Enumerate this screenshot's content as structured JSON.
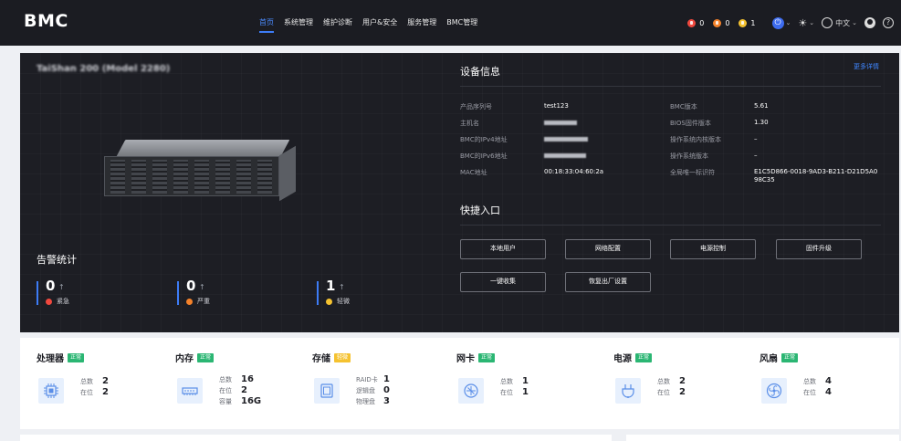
{
  "app": {
    "logo": "BMC"
  },
  "nav": {
    "items": [
      {
        "label": "首页",
        "active": true
      },
      {
        "label": "系统管理",
        "active": false
      },
      {
        "label": "维护诊断",
        "active": false
      },
      {
        "label": "用户&安全",
        "active": false
      },
      {
        "label": "服务管理",
        "active": false
      },
      {
        "label": "BMC管理",
        "active": false
      }
    ]
  },
  "toolbar": {
    "alarms": [
      {
        "count": "0",
        "color": "#f0483e",
        "icon": "critical-alarm-icon"
      },
      {
        "count": "0",
        "color": "#f5822a",
        "icon": "major-alarm-icon"
      },
      {
        "count": "1",
        "color": "#f5c230",
        "icon": "minor-alarm-icon"
      }
    ],
    "power_icon": "power-icon",
    "brightness_icon": "sun-icon",
    "language_label": "中文",
    "user_icon": "user-icon",
    "help_icon": "help-icon"
  },
  "hero": {
    "model_title": "TaiShan 200 (Model 2280)",
    "alarm_section_title": "告警统计",
    "alarm_stats": [
      {
        "count": "0",
        "label": "紧急",
        "color": "#f0483e"
      },
      {
        "count": "0",
        "label": "严重",
        "color": "#f5822a"
      },
      {
        "count": "1",
        "label": "轻微",
        "color": "#f5c230"
      }
    ],
    "device_info_title": "设备信息",
    "more_details_link": "更多详情",
    "device_info": {
      "left": [
        {
          "label": "产品序列号",
          "value": "test123",
          "masked": false
        },
        {
          "label": "主机名",
          "value": "",
          "masked": true
        },
        {
          "label": "BMC的IPv4地址",
          "value": "",
          "masked": true
        },
        {
          "label": "BMC的IPv6地址",
          "value": "",
          "masked": true
        },
        {
          "label": "MAC地址",
          "value": "00:18:33:04:60:2a",
          "masked": false
        }
      ],
      "right": [
        {
          "label": "BMC版本",
          "value": "5.61"
        },
        {
          "label": "BIOS固件版本",
          "value": "1.30"
        },
        {
          "label": "操作系统内核版本",
          "value": "–"
        },
        {
          "label": "操作系统版本",
          "value": "–"
        },
        {
          "label": "全局唯一标识符",
          "value": "E1C5D866-0018-9AD3-B211-D21D5A0",
          "value2": "98C35"
        }
      ]
    },
    "quick_entry_title": "快捷入口",
    "quick_buttons": [
      "本地用户",
      "网络配置",
      "电源控制",
      "固件升级",
      "一键收集",
      "恢复出厂设置"
    ]
  },
  "resources": [
    {
      "title": "处理器",
      "status": "正常",
      "status_color": "#2bb673",
      "icon": "cpu-icon",
      "stats": [
        {
          "k": "总数",
          "v": "2"
        },
        {
          "k": "在位",
          "v": "2"
        }
      ]
    },
    {
      "title": "内存",
      "status": "正常",
      "status_color": "#2bb673",
      "icon": "memory-icon",
      "stats": [
        {
          "k": "总数",
          "v": "16"
        },
        {
          "k": "在位",
          "v": "2"
        },
        {
          "k": "容量",
          "v": "16G"
        }
      ]
    },
    {
      "title": "存储",
      "status": "轻微",
      "status_color": "#f5c230",
      "icon": "storage-icon",
      "stats": [
        {
          "k": "RAID卡",
          "v": "1"
        },
        {
          "k": "逻辑盘",
          "v": "0"
        },
        {
          "k": "物理盘",
          "v": "3"
        }
      ]
    },
    {
      "title": "网卡",
      "status": "正常",
      "status_color": "#2bb673",
      "icon": "nic-icon",
      "stats": [
        {
          "k": "总数",
          "v": "1"
        },
        {
          "k": "在位",
          "v": "1"
        }
      ]
    },
    {
      "title": "电源",
      "status": "正常",
      "status_color": "#2bb673",
      "icon": "power-supply-icon",
      "stats": [
        {
          "k": "总数",
          "v": "2"
        },
        {
          "k": "在位",
          "v": "2"
        }
      ]
    },
    {
      "title": "风扇",
      "status": "正常",
      "status_color": "#2bb673",
      "icon": "fan-icon",
      "stats": [
        {
          "k": "总数",
          "v": "4"
        },
        {
          "k": "在位",
          "v": "4"
        }
      ]
    }
  ]
}
